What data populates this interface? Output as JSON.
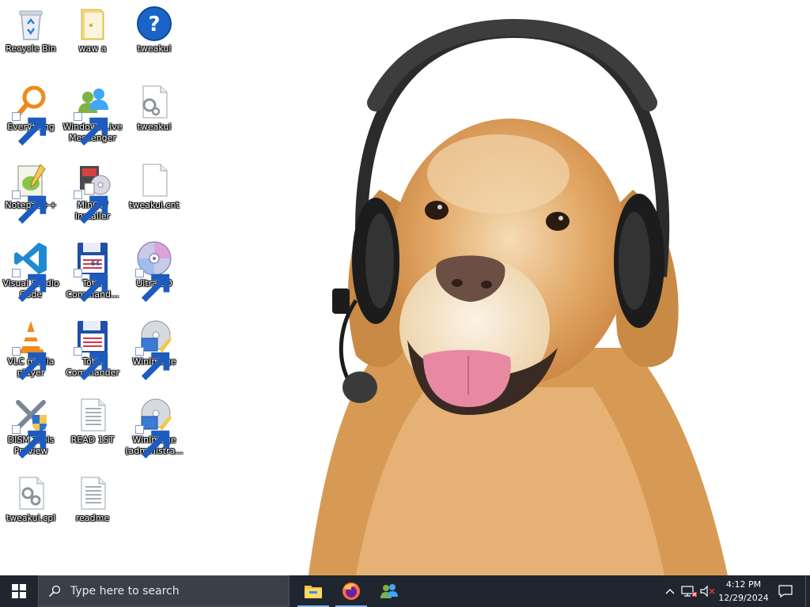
{
  "desktop": {
    "icons": [
      {
        "id": "recycle-bin",
        "label": "Recycle Bin",
        "icon": "recycle-bin-icon",
        "shortcut": false
      },
      {
        "id": "waw-a",
        "label": "waw a",
        "icon": "folder-icon",
        "shortcut": false
      },
      {
        "id": "tweakui-help",
        "label": "tweakui",
        "icon": "help-icon",
        "shortcut": false
      },
      {
        "id": "everything",
        "label": "Everything",
        "icon": "everything-search-icon",
        "shortcut": true
      },
      {
        "id": "windows-live-messenger",
        "label": "Windows Live Messenger",
        "icon": "messenger-icon",
        "shortcut": true
      },
      {
        "id": "tweakui-file",
        "label": "tweakui",
        "icon": "settings-file-icon",
        "shortcut": false
      },
      {
        "id": "notepad-plus-plus",
        "label": "Notepad++",
        "icon": "notepad-plus-plus-icon",
        "shortcut": true
      },
      {
        "id": "mingw-installer",
        "label": "MinGW Installer",
        "icon": "installer-icon",
        "shortcut": true
      },
      {
        "id": "tweakui-cnt",
        "label": "tweakui.cnt",
        "icon": "blank-file-icon",
        "shortcut": false
      },
      {
        "id": "visual-studio-code",
        "label": "Visual Studio Code",
        "icon": "vscode-icon",
        "shortcut": true
      },
      {
        "id": "total-commander-64",
        "label": "Total Command...",
        "icon": "total-commander-64-icon",
        "shortcut": true
      },
      {
        "id": "ultraiso",
        "label": "UltraISO",
        "icon": "disc-icon",
        "shortcut": true
      },
      {
        "id": "vlc",
        "label": "VLC media player",
        "icon": "vlc-cone-icon",
        "shortcut": true
      },
      {
        "id": "total-commander",
        "label": "Total Commander",
        "icon": "total-commander-icon",
        "shortcut": true
      },
      {
        "id": "winimage",
        "label": "WinImage",
        "icon": "winimage-icon",
        "shortcut": true
      },
      {
        "id": "dism-tools",
        "label": "DISM Tools Preview",
        "icon": "dism-tools-icon",
        "shortcut": true
      },
      {
        "id": "readme-1st",
        "label": "READ 1ST",
        "icon": "text-document-icon",
        "shortcut": false
      },
      {
        "id": "winimage-admin",
        "label": "WinImage (administra...",
        "icon": "winimage-icon",
        "shortcut": true
      },
      {
        "id": "tweakui-cpl",
        "label": "tweakui.cpl",
        "icon": "control-panel-file-icon",
        "shortcut": false
      },
      {
        "id": "readme",
        "label": "readme",
        "icon": "text-document-icon",
        "shortcut": false
      }
    ]
  },
  "taskbar": {
    "start_icon": "windows-logo-icon",
    "search_placeholder": "Type here to search",
    "pinned_apps": [
      {
        "id": "file-explorer",
        "icon": "file-explorer-icon",
        "running": true
      },
      {
        "id": "firefox",
        "icon": "firefox-icon",
        "running": true
      },
      {
        "id": "messenger",
        "icon": "messenger-icon",
        "running": false
      }
    ],
    "tray": {
      "icons": [
        "chevron-up-icon",
        "network-icon",
        "volume-muted-icon"
      ],
      "time": "4:12 PM",
      "date": "12/29/2024"
    }
  },
  "colors": {
    "taskbar_bg": "#1f2630",
    "search_bg": "#3a4048",
    "accent": "#0078d7"
  }
}
